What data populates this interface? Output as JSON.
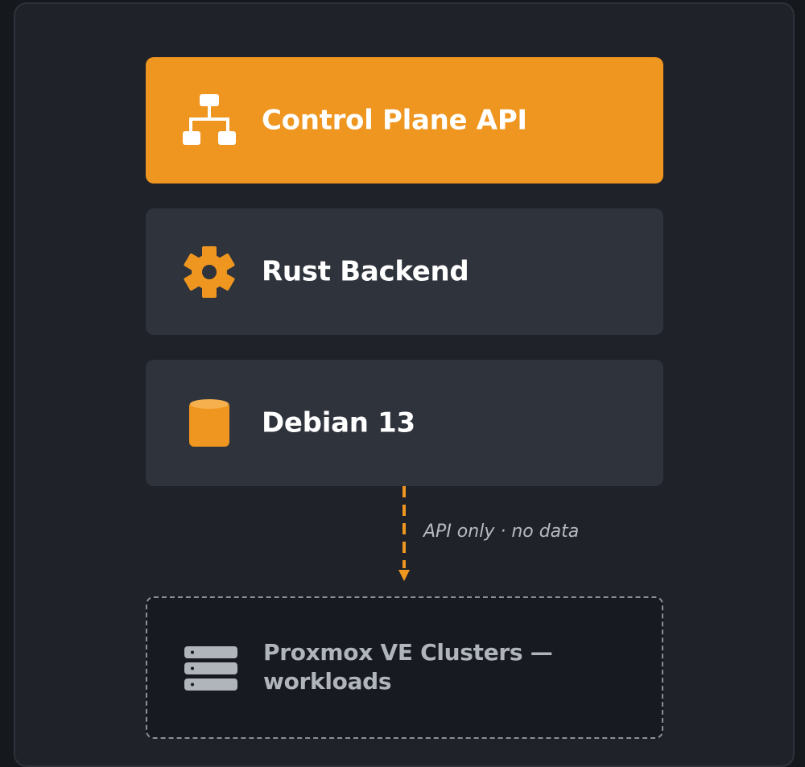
{
  "colors": {
    "accent": "#ee961f",
    "background": "#1f2229",
    "card": "#2f333c",
    "muted_text": "#b0b4bb"
  },
  "layers": [
    {
      "label": "Control Plane API",
      "icon": "sitemap-icon",
      "style": "accent"
    },
    {
      "label": "Rust Backend",
      "icon": "gear-icon",
      "style": "default"
    },
    {
      "label": "Debian 13",
      "icon": "cylinder-icon",
      "style": "default"
    }
  ],
  "connector": {
    "label": "API only · no data",
    "style": "dashed-arrow"
  },
  "target": {
    "label": "Proxmox VE Clusters — workloads",
    "icon": "server-icon",
    "style": "dashed"
  }
}
